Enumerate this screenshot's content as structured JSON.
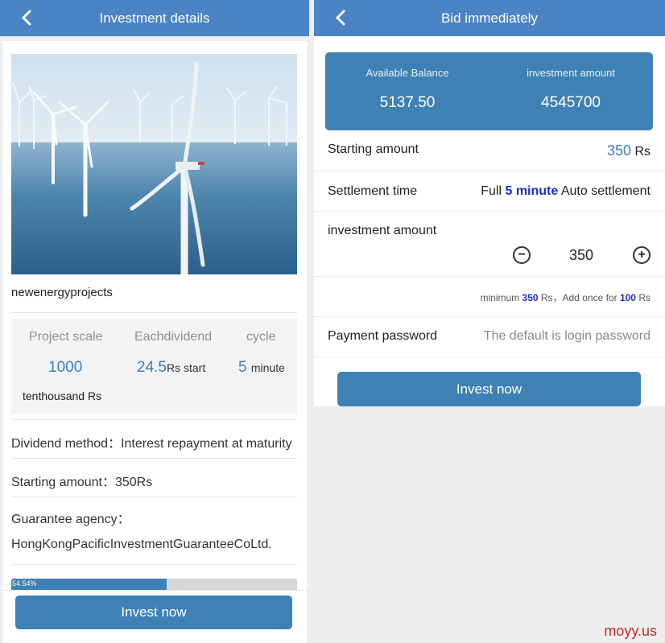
{
  "left": {
    "title": "Investment details",
    "project_name": "newenergyprojects",
    "stats": {
      "scale_label": "Project scale",
      "scale_value": "1000",
      "scale_unit": "tenthousand Rs",
      "dividend_label": "Eachdividend",
      "dividend_value": "24.5",
      "dividend_unit": "Rs start",
      "cycle_label": "cycle",
      "cycle_value": "5",
      "cycle_unit": "minute"
    },
    "dividend_method": "Dividend method：Interest repayment at maturity",
    "starting_amount": "Starting amount：350Rs",
    "guarantee_label": "Guarantee agency：",
    "guarantee_value": "HongKongPacificInvestmentGuaranteeCoLtd.",
    "progress_text": "54.54%",
    "progress_fraction": 0.545,
    "invest_button": "Invest now"
  },
  "right": {
    "title": "Bid immediately",
    "balance": {
      "available_label": "Available Balance",
      "available_value": "5137.50",
      "investment_label": "investment amount",
      "investment_value": "4545700"
    },
    "starting_amount_label": "Starting amount",
    "starting_amount_value": "350",
    "starting_amount_unit": "Rs",
    "settlement_label": "Settlement time",
    "settlement_pre": "Full",
    "settlement_value": "5 minute",
    "settlement_post": "Auto settlement",
    "investment_amount_label": "investment amount",
    "quantity": "350",
    "hint_pre": "minimum",
    "hint_min": "350",
    "hint_mid": "Rs，Add once for",
    "hint_step": "100",
    "hint_post": "Rs",
    "password_label": "Payment password",
    "password_placeholder": "The default is login password",
    "invest_button": "Invest now"
  },
  "watermark": "moyy.us",
  "colors": {
    "header": "#4a84c5",
    "accent": "#3e81b4",
    "value_blue": "#3b7fbd",
    "highlight_blue": "#1a2fd0",
    "watermark_red": "#c42b2b"
  }
}
